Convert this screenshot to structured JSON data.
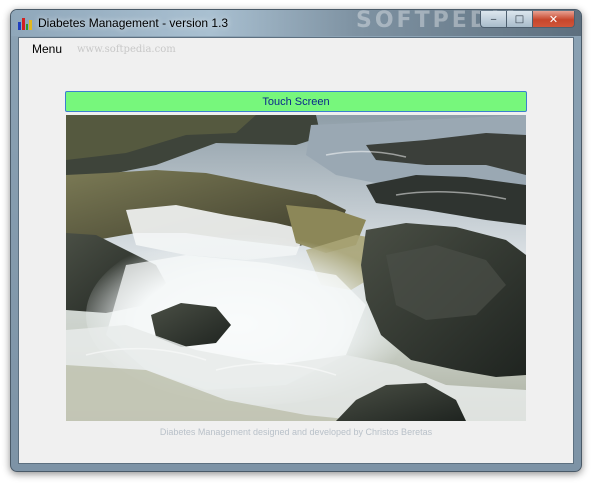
{
  "window": {
    "title": "Diabetes Management - version 1.3",
    "title_watermark": "SOFTPEDIA",
    "minimize_glyph": "‒",
    "maximize_glyph": "□",
    "close_glyph": "✕"
  },
  "menu": {
    "items": [
      {
        "label": "Menu"
      }
    ],
    "watermark": "www.softpedia.com"
  },
  "main": {
    "touch_button_label": "Touch Screen",
    "photo_description": "waterfall",
    "credit": "Diabetes Management designed and developed by Christos Beretas"
  },
  "colors": {
    "touch_button_bg": "#77f77c",
    "touch_button_border": "#3b7fcf",
    "credit_text": "#b9c1c9"
  }
}
